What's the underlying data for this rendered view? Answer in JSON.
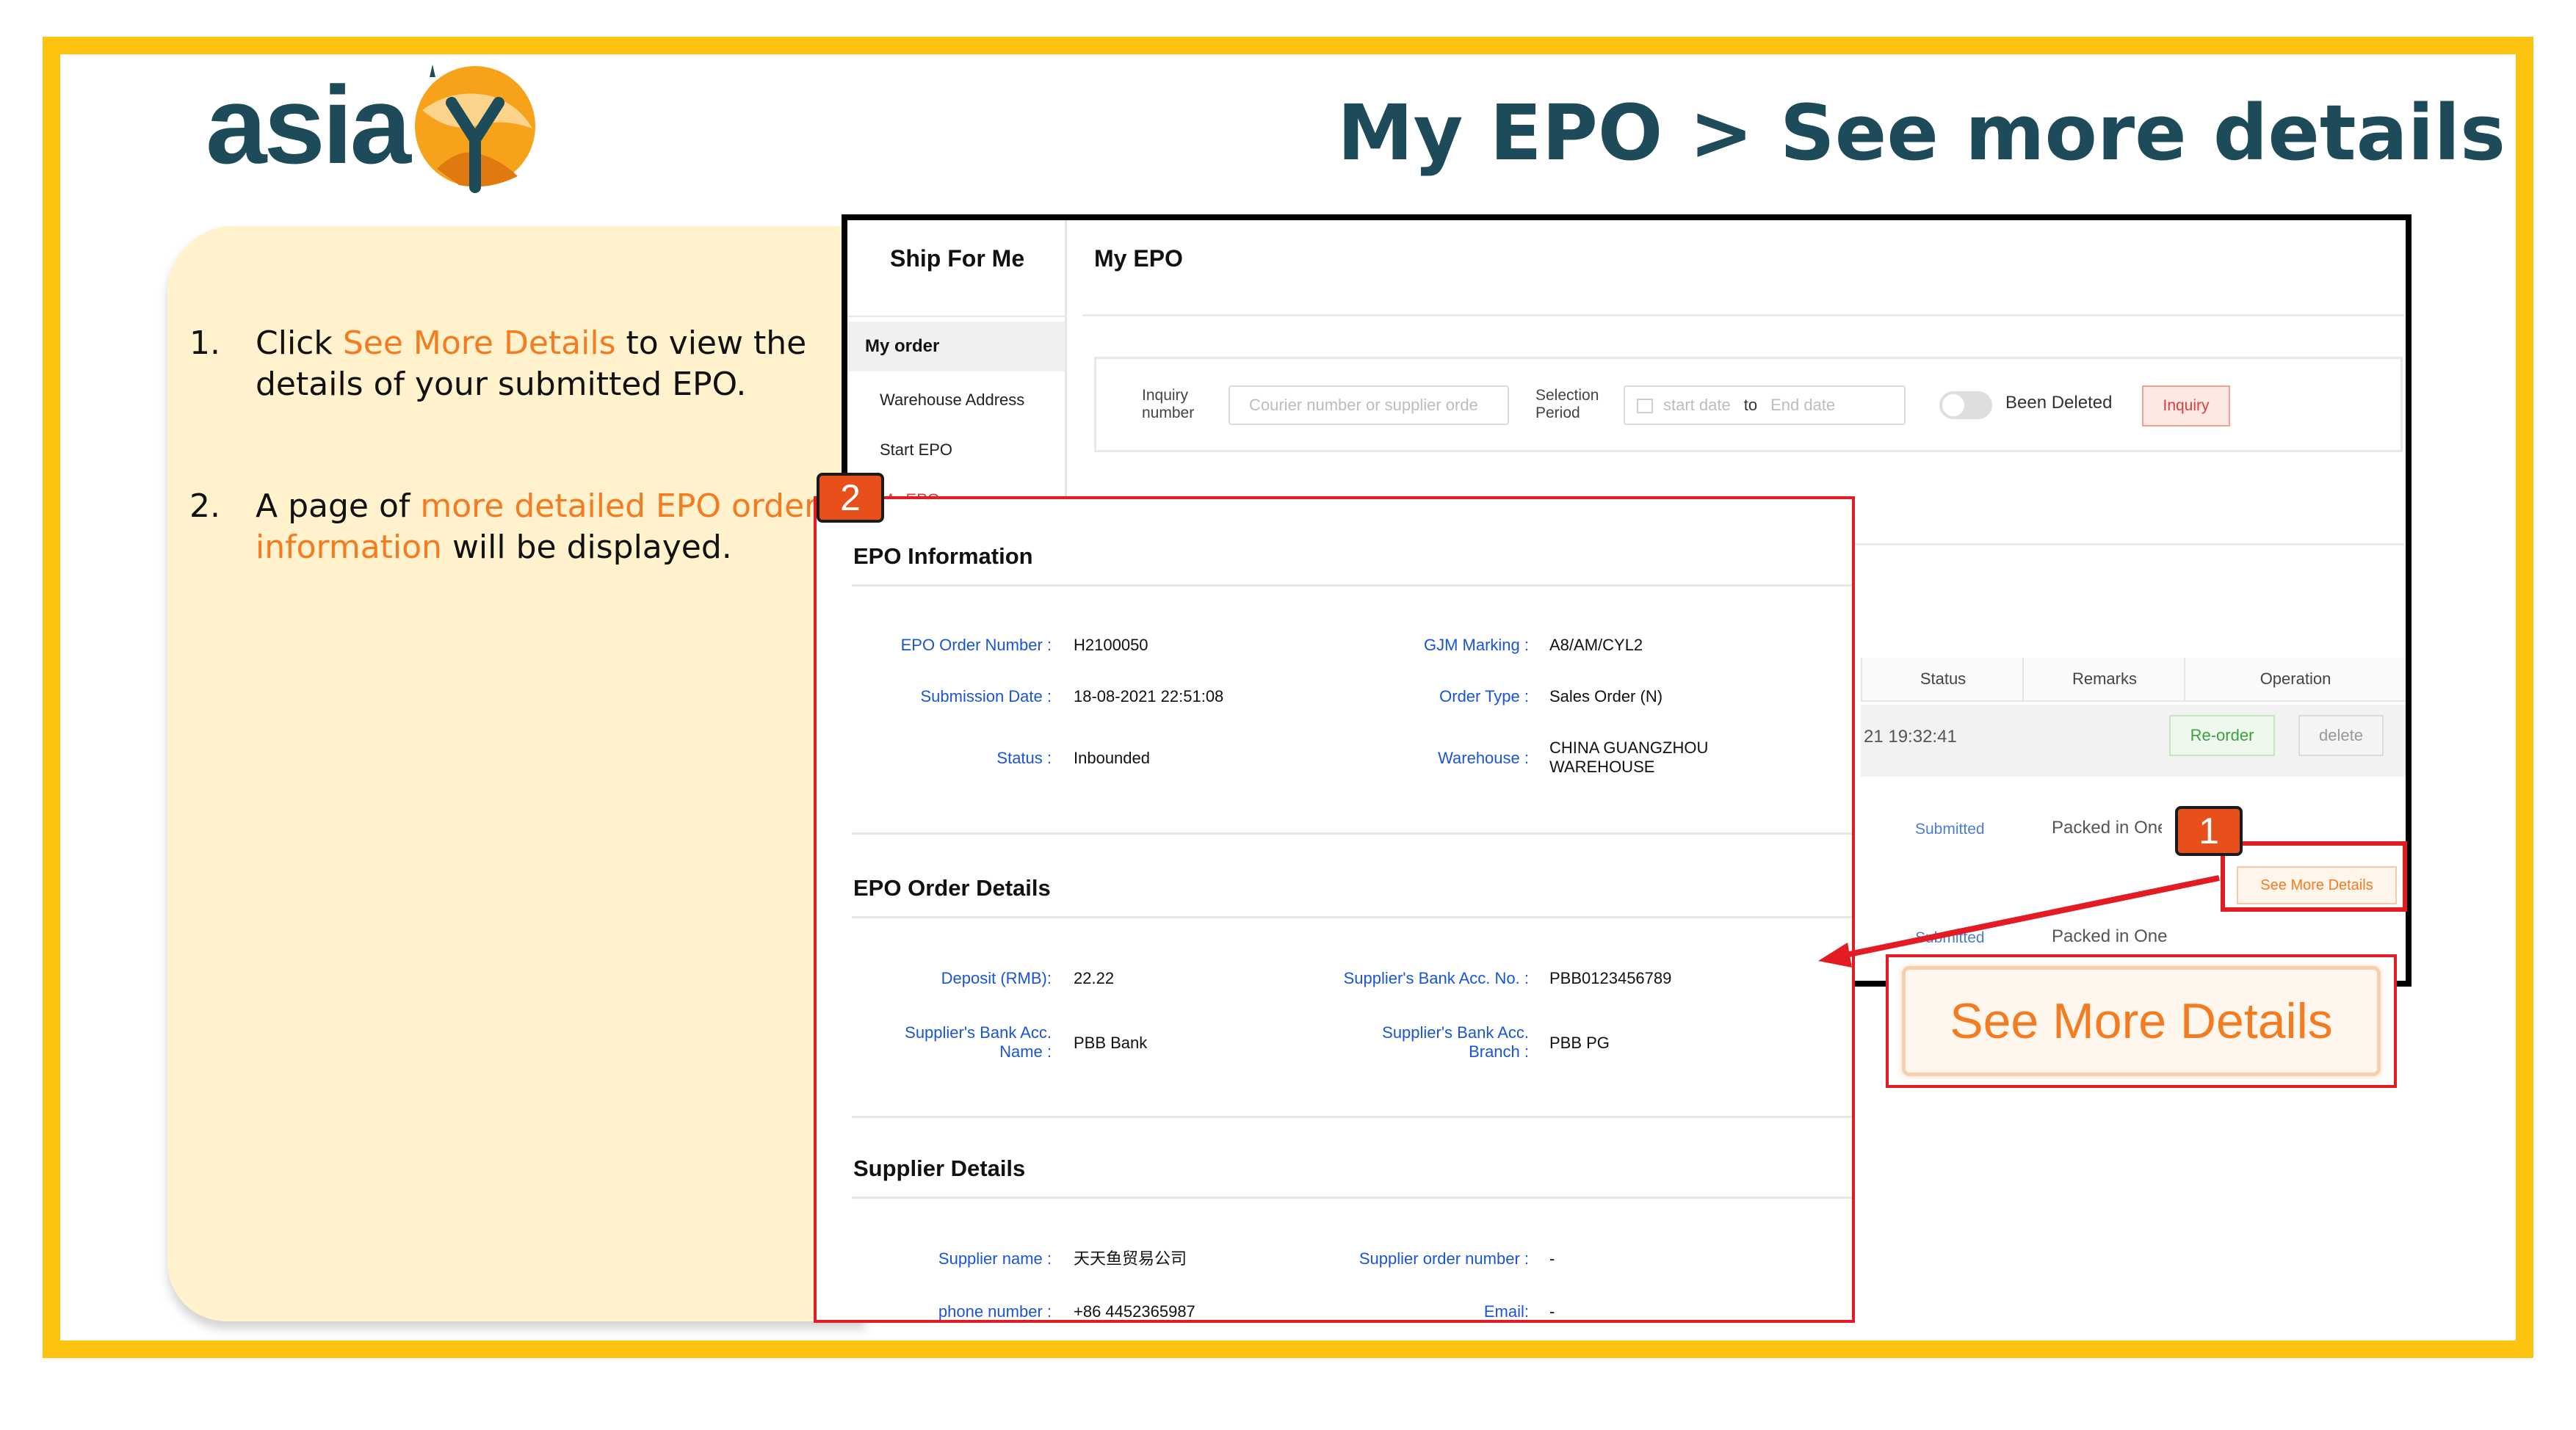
{
  "header": {
    "logo_text": "asia",
    "title": "My EPO > See more details"
  },
  "instructions": [
    {
      "num": "1.",
      "pre": "Click ",
      "highlight": "See More Details",
      "post": " to view the details of your submitted EPO."
    },
    {
      "num": "2.",
      "pre": "A page of ",
      "highlight": "more detailed EPO order information",
      "post": " will be displayed."
    }
  ],
  "app": {
    "sidebar": {
      "title": "Ship For Me",
      "my_order": "My order",
      "items": [
        "Warehouse Address",
        "Start EPO",
        "My EPO"
      ]
    },
    "main_title": "My EPO",
    "filter": {
      "inquiry_label": "Inquiry number",
      "inquiry_placeholder": "Courier number or supplier orde",
      "period_label": "Selection Period",
      "start_placeholder": "start date",
      "to": "to",
      "end_placeholder": "End date",
      "deleted_label": "Been Deleted",
      "inquiry_button": "Inquiry"
    },
    "table": {
      "headers": [
        "Status",
        "Remarks",
        "Operation"
      ],
      "row1": {
        "time": "21 19:32:41",
        "reorder": "Re-order",
        "delete": "delete"
      },
      "row2": {
        "status": "Submitted",
        "remarks": "Packed in One",
        "action": "See More Details"
      },
      "row3": {
        "status": "Submitted",
        "remarks": "Packed in One"
      }
    },
    "zoom_button": "See More Details"
  },
  "details": {
    "epo_info": {
      "heading": "EPO Information",
      "fields": [
        {
          "label": "EPO Order Number :",
          "value": "H2100050"
        },
        {
          "label": "Submission Date :",
          "value": "18-08-2021 22:51:08"
        },
        {
          "label": "Status :",
          "value": "Inbounded"
        },
        {
          "label": "GJM Marking :",
          "value": "A8/AM/CYL2"
        },
        {
          "label": "Order Type :",
          "value": "Sales Order (N)"
        },
        {
          "label": "Warehouse :",
          "value": "CHINA GUANGZHOU WAREHOUSE"
        }
      ]
    },
    "order_details": {
      "heading": "EPO Order Details",
      "fields": [
        {
          "label": "Deposit (RMB):",
          "value": "22.22"
        },
        {
          "label": "Supplier's Bank Acc. Name :",
          "value": "PBB Bank"
        },
        {
          "label": "Supplier's Bank Acc. No. :",
          "value": "PBB0123456789"
        },
        {
          "label": "Supplier's Bank Acc. Branch :",
          "value": "PBB PG"
        }
      ]
    },
    "supplier": {
      "heading": "Supplier Details",
      "fields": [
        {
          "label": "Supplier name :",
          "value": "天天鱼贸易公司"
        },
        {
          "label": "phone number :",
          "value": "+86 4452365987"
        },
        {
          "label": "Supplier order number :",
          "value": "-"
        },
        {
          "label": "Email:",
          "value": "-"
        }
      ]
    }
  },
  "badges": [
    "1",
    "2"
  ],
  "colors": {
    "frame": "#FBC210",
    "title": "#1D4B5A",
    "highlight": "#F47B20",
    "callout": "#E31B23",
    "badge": "#E8501B",
    "label_blue": "#1A55D8"
  }
}
